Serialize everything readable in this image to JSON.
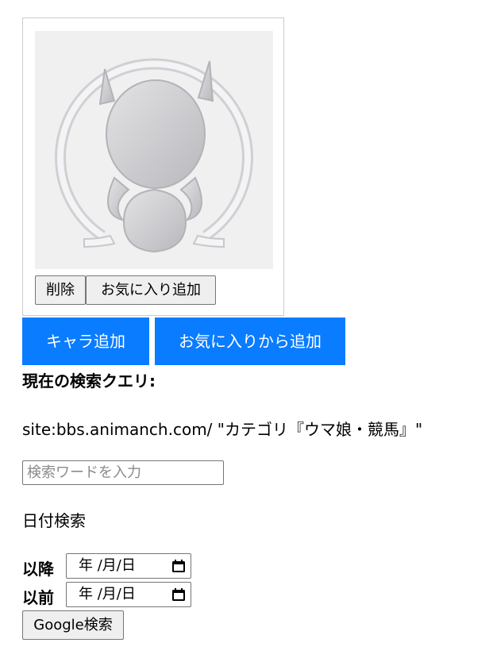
{
  "card": {
    "delete_label": "削除",
    "favorite_add_label": "お気に入り追加"
  },
  "actions": {
    "add_character_label": "キャラ追加",
    "add_from_favorites_label": "お気に入りから追加"
  },
  "query": {
    "heading": "現在の検索クエリ:",
    "value": "site:bbs.animanch.com/ \"カテゴリ『ウマ娘・競馬』\""
  },
  "search": {
    "placeholder": "検索ワードを入力"
  },
  "date_search": {
    "heading": "日付検索",
    "after_label": "以降",
    "before_label": "以前",
    "date_placeholder": "年 /月/日"
  },
  "submit": {
    "label": "Google検索"
  },
  "colors": {
    "accent": "#0a7cff",
    "button_gray": "#efefef"
  }
}
